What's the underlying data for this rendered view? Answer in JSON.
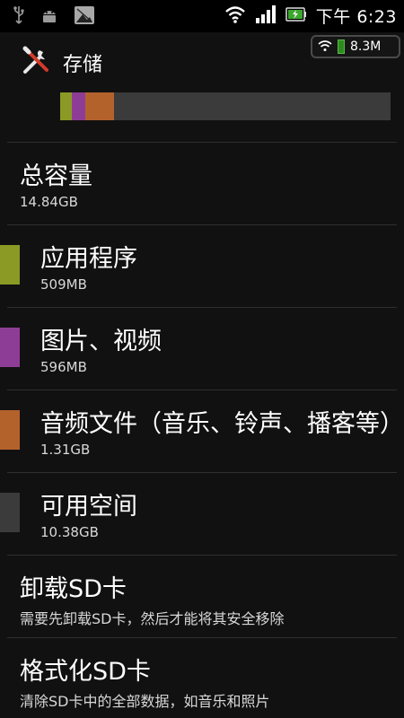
{
  "status_bar": {
    "time": "下午 6:23",
    "icons": [
      "usb-icon",
      "android-debug-icon",
      "gallery-icon",
      "wifi-icon",
      "signal-icon",
      "battery-icon"
    ]
  },
  "network_badge": {
    "speed": "8.3M"
  },
  "header": {
    "title": "存储",
    "icon": "tools-icon"
  },
  "storage": {
    "total_label": "总容量",
    "total_value": "14.84GB",
    "usage_fractions": {
      "apps": 0.034,
      "pictures_videos": 0.04,
      "audio": 0.088
    },
    "categories": [
      {
        "name": "应用程序",
        "size": "509MB",
        "color": "#8a9a24"
      },
      {
        "name": "图片、视频",
        "size": "596MB",
        "color": "#8e3d96"
      },
      {
        "name": "音频文件（音乐、铃声、播客等）",
        "size": "1.31GB",
        "color": "#b4622c"
      },
      {
        "name": "可用空间",
        "size": "10.38GB",
        "color": "#3b3b3b"
      }
    ]
  },
  "actions": [
    {
      "title": "卸载SD卡",
      "subtitle": "需要先卸载SD卡，然后才能将其安全移除"
    },
    {
      "title": "格式化SD卡",
      "subtitle": "清除SD卡中的全部数据，如音乐和照片"
    }
  ],
  "colors": {
    "background": "#111111",
    "divider": "#2f2f2f",
    "usage_bar_free": "#3b3b3b"
  }
}
